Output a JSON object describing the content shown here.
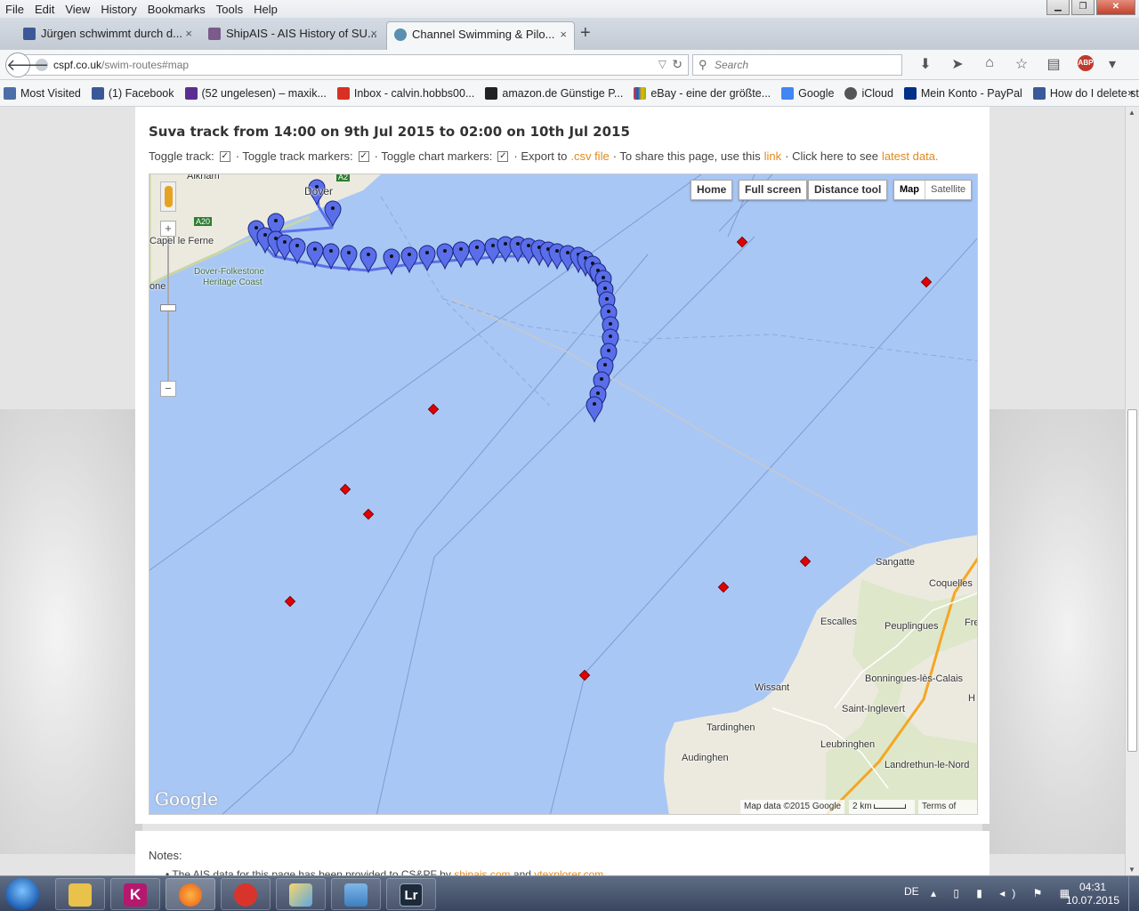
{
  "browser": {
    "menu": [
      "File",
      "Edit",
      "View",
      "History",
      "Bookmarks",
      "Tools",
      "Help"
    ],
    "tabs": [
      {
        "title": "Jürgen schwimmt durch d...",
        "close": "×",
        "icon_color": "#3b5998"
      },
      {
        "title": "ShipAIS - AIS History of SU...",
        "close": "×",
        "icon_color": "#7a5b8a"
      },
      {
        "title": "Channel Swimming & Pilo...",
        "close": "×",
        "icon_color": "#5a8fb0"
      }
    ],
    "new_tab": "+",
    "url_host": "cspf.co.uk",
    "url_path": "/swim-routes#map",
    "search_placeholder": "Search",
    "bookmarks": [
      {
        "label": "Most Visited",
        "icon_color": "#4b6fa6"
      },
      {
        "label": "(1) Facebook",
        "icon_color": "#3b5998"
      },
      {
        "label": "(52 ungelesen) – maxik...",
        "icon_color": "#5c2d91"
      },
      {
        "label": "Inbox - calvin.hobbs00...",
        "icon_color": "#d93025"
      },
      {
        "label": "amazon.de Günstige P...",
        "icon_color": "#222222"
      },
      {
        "label": "eBay - eine der größte...",
        "icon_color": "#e53238"
      },
      {
        "label": "Google",
        "icon_color": "#4285f4"
      },
      {
        "label": "iCloud",
        "icon_color": "#555555"
      },
      {
        "label": "Mein Konto - PayPal",
        "icon_color": "#003087"
      },
      {
        "label": "How do I delete stuff f...",
        "icon_color": "#3b5998"
      }
    ],
    "bookmarks_more": "»"
  },
  "page": {
    "title": "Suva track from 14:00 on 9th Jul 2015 to 02:00 on 10th Jul 2015",
    "toggle_track": "Toggle track:",
    "toggle_track_markers": "· Toggle track markers:",
    "toggle_chart_markers": "· Toggle chart markers:",
    "export_prefix": "· Export to",
    "export_link": ".csv file",
    "share_prefix": "· To share this page, use this",
    "share_link": "link",
    "latest_prefix": "· Click here to see",
    "latest_link": "latest data.",
    "checkbox_mark": "✓",
    "notes_label": "Notes:",
    "notes_line_prefix": "• The AIS data for this page has been provided to CS&PF by",
    "notes_link1": "shipais.com",
    "notes_and": "and",
    "notes_link2": "vtexplorer.com"
  },
  "map": {
    "buttons": {
      "home": "Home",
      "fullscreen": "Full screen",
      "distance": "Distance tool"
    },
    "map_types": {
      "map": "Map",
      "satellite": "Satellite"
    },
    "zoom_in": "+",
    "zoom_out": "−",
    "google_logo": "Google",
    "attribution": "Map data ©2015 Google",
    "scale": "2 km",
    "terms": "Terms of Use",
    "place_labels": {
      "alkham": "Alkham",
      "dover": "Dover",
      "capel": "Capel le Ferne",
      "a20": "A20",
      "a2": "A2",
      "one": "one",
      "heritage": "Dover-Folkestone",
      "heritage2": "Heritage Coast",
      "sangatte": "Sangatte",
      "coquelles": "Coquelles",
      "escalles": "Escalles",
      "peuplingues": "Peuplingues",
      "fre": "Fre",
      "wissant": "Wissant",
      "bonningues": "Bonningues-lès-Calais",
      "h": "H",
      "saint": "Saint-Inglevert",
      "tardinghen": "Tardinghen",
      "leubringhen": "Leubringhen",
      "audinghen": "Audinghen",
      "landrethun": "Landrethun-le-Nord"
    },
    "colors": {
      "sea": "#a9c7f5",
      "land": "#eceadf",
      "track": "#5b6fe8",
      "marker": "#5a6eea",
      "chart_marker": "#e00000"
    }
  },
  "taskbar": {
    "lang": "DE",
    "time": "04:31",
    "date": "10.07.2015",
    "apps": [
      "folder",
      "kobo",
      "firefox",
      "ccleaner",
      "paint",
      "photos",
      "lightroom"
    ],
    "app_labels": {
      "kobo": "K",
      "lightroom": "Lr"
    }
  }
}
